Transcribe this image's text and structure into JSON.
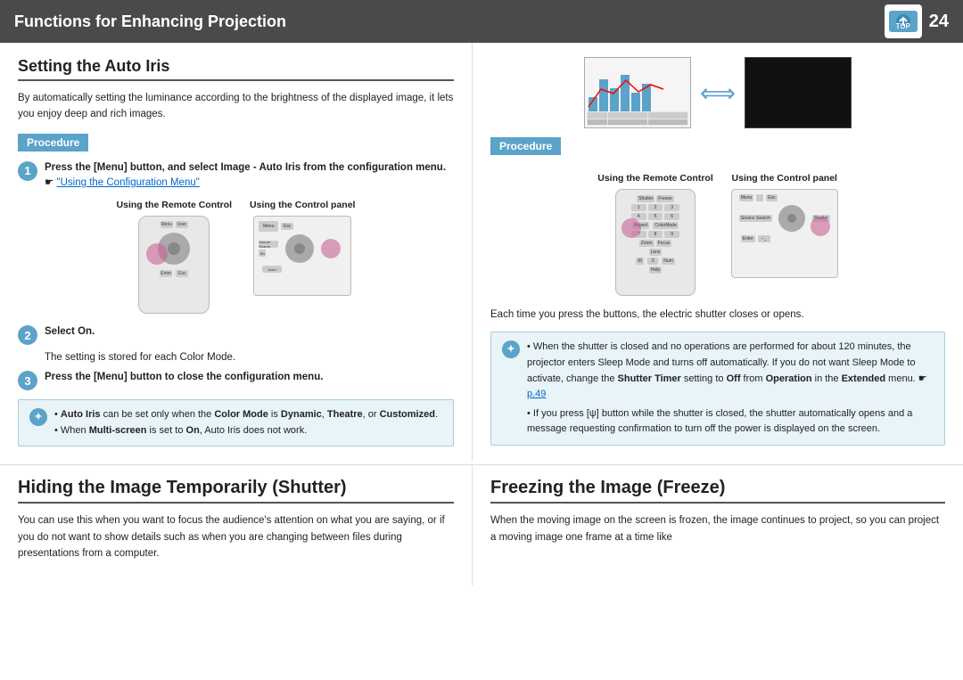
{
  "header": {
    "title": "Functions for Enhancing Projection",
    "page_number": "24",
    "logo_text": "TOP"
  },
  "left_section": {
    "title": "Setting the Auto Iris",
    "intro": "By automatically setting the luminance according to the brightness of the displayed image, it lets you enjoy deep and rich images.",
    "procedure_label": "Procedure",
    "steps": [
      {
        "num": "1",
        "text": "Press the [Menu] button, and select Image - Auto Iris from the configuration menu.",
        "link": "\"Using the Configuration Menu\""
      },
      {
        "num": "2",
        "text": "Select On."
      },
      {
        "num": "2",
        "sub_text": "The setting is stored for each Color Mode."
      },
      {
        "num": "3",
        "text": "Press the [Menu] button to close the configuration menu."
      }
    ],
    "diagram_label_remote": "Using the Remote Control",
    "diagram_label_panel": "Using the Control panel",
    "note_items": [
      "Auto Iris can be set only when the Color Mode is Dynamic, Theatre, or Customized.",
      "When Multi-screen is set to On, Auto Iris does not work."
    ]
  },
  "right_section": {
    "procedure_label": "Procedure",
    "diagram_label_remote": "Using the Remote Control",
    "diagram_label_panel": "Using the Control panel",
    "each_time_text": "Each time you press the buttons, the electric shutter closes or opens.",
    "note_items": [
      "When the shutter is closed and no operations are performed for about 120 minutes, the projector enters Sleep Mode and turns off automatically. If you do not want Sleep Mode to activate, change the Shutter Timer setting to Off from Operation in the Extended menu.",
      "p.49",
      "If you press [ψ] button while the shutter is closed, the shutter automatically opens and a message requesting confirmation to turn off the power is displayed on the screen."
    ]
  },
  "bottom_left": {
    "title": "Hiding the Image Temporarily (Shutter)",
    "text": "You can use this when you want to focus the audience's attention on what you are saying, or if you do not want to show details such as when you are changing between files during presentations from a computer."
  },
  "bottom_right": {
    "title": "Freezing the Image (Freeze)",
    "text": "When the moving image on the screen is frozen, the image continues to project, so you can project a moving image one frame at a time like"
  }
}
